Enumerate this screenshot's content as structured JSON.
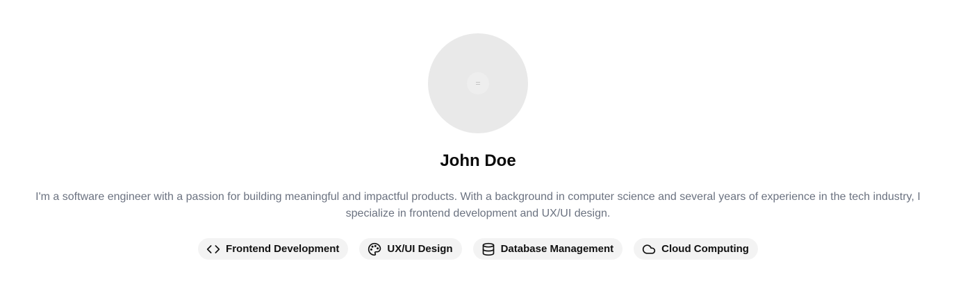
{
  "profile": {
    "name": "John Doe",
    "bio_line1": "I'm a software engineer with a passion for building meaningful and impactful products. With a background in computer science and several years of experience in the tech industry, I",
    "bio_line2": "specialize in frontend development and UX/UI design."
  },
  "skills": [
    {
      "label": "Frontend Development",
      "icon": "code-icon"
    },
    {
      "label": "UX/UI Design",
      "icon": "palette-icon"
    },
    {
      "label": "Database Management",
      "icon": "database-icon"
    },
    {
      "label": "Cloud Computing",
      "icon": "cloud-icon"
    }
  ],
  "colors": {
    "avatar_bg": "#e9e9e9",
    "tag_bg": "#f3f3f3",
    "bio_text": "#6b7280"
  }
}
